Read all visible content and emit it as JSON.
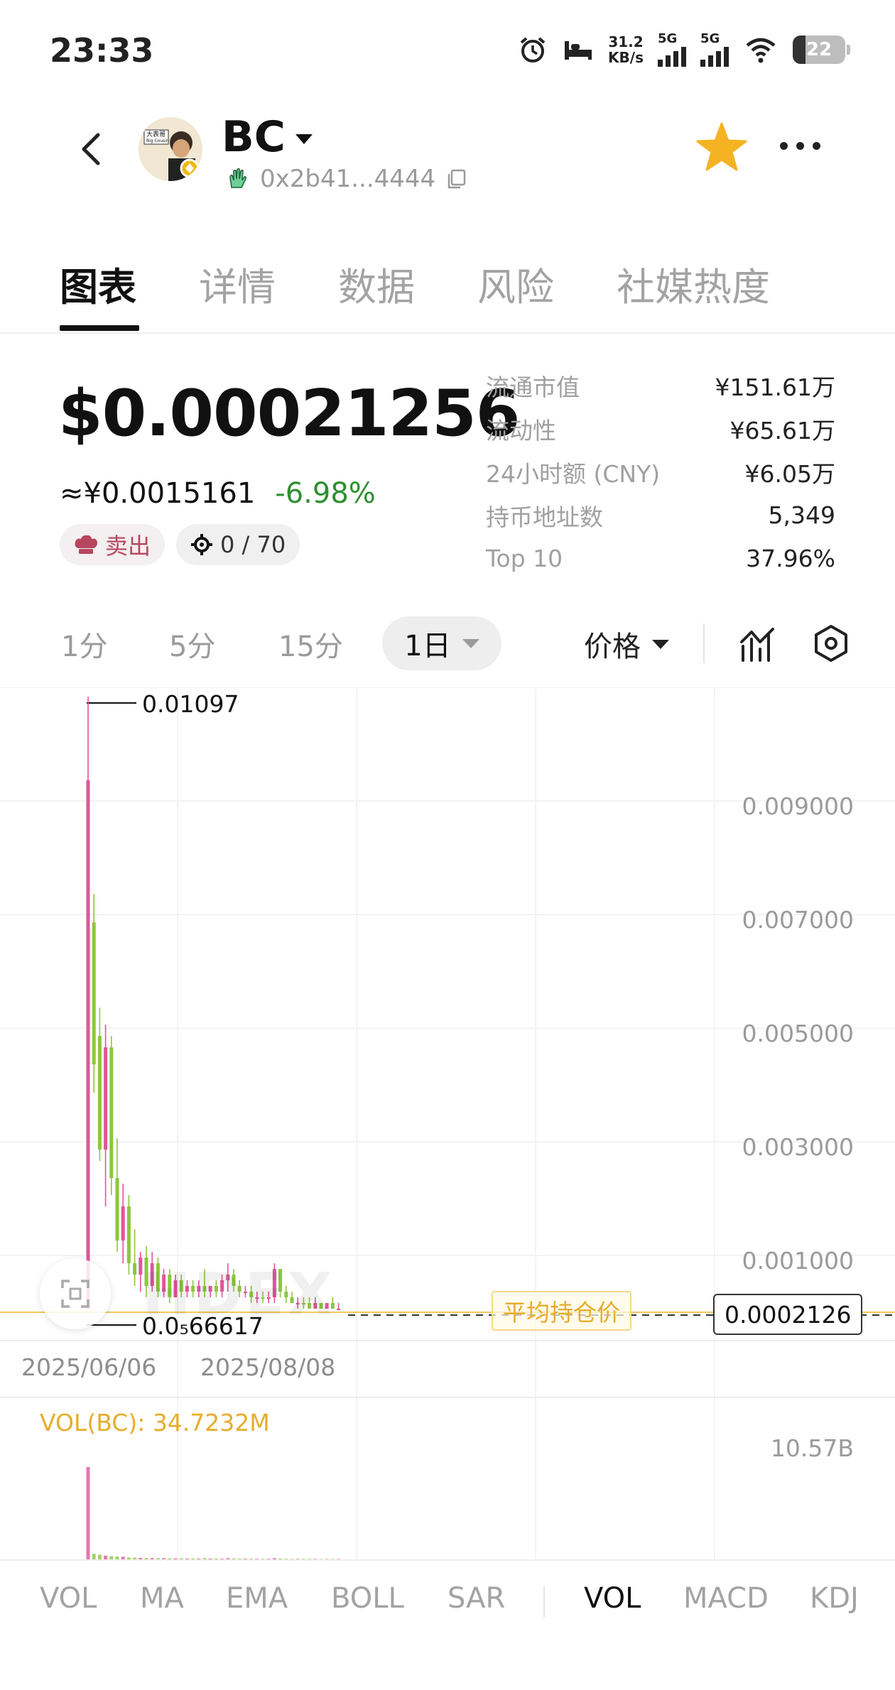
{
  "status_bar": {
    "time": "23:33",
    "net_speed_value": "31.2",
    "net_speed_unit": "KB/s",
    "sim1": "5G",
    "sim2": "5G",
    "battery": "22"
  },
  "header": {
    "token_name": "BC",
    "address": "0x2b41...4444",
    "icons": [
      "back-icon",
      "token-avatar",
      "dropdown-caret-icon",
      "hand-icon",
      "copy-icon",
      "star-icon",
      "more-icon"
    ],
    "favorite_color": "#f5b324"
  },
  "tabs": [
    "图表",
    "详情",
    "数据",
    "风险",
    "社媒热度"
  ],
  "active_tab": "图表",
  "price": {
    "usd": "$0.00021256",
    "cny": "≈¥0.0015161",
    "change": "-6.98%",
    "change_color": "#2f8f2f"
  },
  "pills": {
    "sell_label": "卖出",
    "count": "0 / 70"
  },
  "stats": [
    {
      "label": "流通市值",
      "value": "¥151.61万"
    },
    {
      "label": "流动性",
      "value": "¥65.61万"
    },
    {
      "label": "24小时额 (CNY)",
      "value": "¥6.05万"
    },
    {
      "label": "持币地址数",
      "value": "5,349"
    },
    {
      "label": "Top 10",
      "value": "37.96%"
    }
  ],
  "timeframes": [
    "1分",
    "5分",
    "15分"
  ],
  "timeframe_selected": "1日",
  "price_selector": "价格",
  "chart": {
    "y_labels": [
      "0.009000",
      "0.007000",
      "0.005000",
      "0.003000",
      "0.001000"
    ],
    "x_labels": [
      "2025/06/06",
      "2025/08/08"
    ],
    "max_label": "0.01097",
    "min_label": "0.0₅66617",
    "avg_label": "平均持仓价",
    "current_price": "0.0002126",
    "watermark": "HDEX",
    "vol_label": "VOL(BC): 34.7232M",
    "vol_max": "10.57B",
    "up_color": "#e0559a",
    "down_color": "#8cc63f"
  },
  "indicators_main": [
    "VOL",
    "MA",
    "EMA",
    "BOLL",
    "SAR"
  ],
  "indicators_sub": [
    "VOL",
    "MACD",
    "KDJ"
  ],
  "indicator_sub_active": "VOL"
}
